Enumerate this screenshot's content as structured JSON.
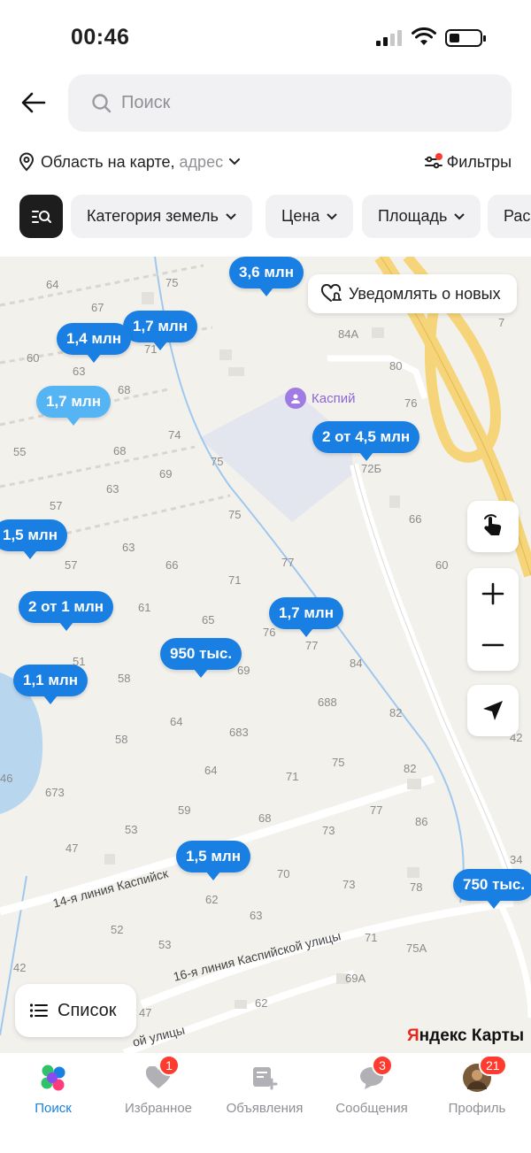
{
  "status_bar": {
    "time": "00:46"
  },
  "search": {
    "placeholder": "Поиск"
  },
  "location": {
    "label": "Область на карте,",
    "muted": "адрес"
  },
  "filters": {
    "label": "Фильтры",
    "accent": "#ff3b30"
  },
  "chips": [
    "Категория земель",
    "Цена",
    "Площадь",
    "Рас"
  ],
  "map": {
    "notify_label": "Уведомлять о новых",
    "poi_label": "Каспий",
    "streets": [
      "14-я линия Каспийск",
      "16-я линия Каспийской улицы",
      "ой улицы"
    ],
    "pins": [
      "3,6 млн",
      "1,7 млн",
      "1,4 млн",
      "1,7 млн",
      "2 от 4,5 млн",
      "1,5 млн",
      "2 от 1 млн",
      "1,7 млн",
      "950 тыс.",
      "1,1 млн",
      "1,5 млн",
      "750 тыс."
    ],
    "plot_numbers": [
      "64",
      "75",
      "67",
      "60",
      "63",
      "71",
      "68",
      "55",
      "74",
      "68",
      "75",
      "69",
      "63",
      "57",
      "75",
      "63",
      "57",
      "66",
      "77",
      "71",
      "61",
      "65",
      "76",
      "77",
      "84",
      "51",
      "58",
      "69",
      "64",
      "688",
      "82",
      "58",
      "683",
      "75",
      "82",
      "64",
      "71",
      "46",
      "673",
      "59",
      "68",
      "53",
      "73",
      "77",
      "86",
      "47",
      "70",
      "73",
      "78",
      "62",
      "63",
      "52",
      "71",
      "53",
      "75А",
      "69А",
      "62",
      "42",
      "47",
      "84А",
      "80",
      "76",
      "72Б",
      "66",
      "60",
      "42",
      "34",
      "7"
    ],
    "list_button": "Список",
    "brand": {
      "y": "Я",
      "rest": "ндекс Карты"
    }
  },
  "nav": [
    {
      "label": "Поиск",
      "active": true
    },
    {
      "label": "Избранное",
      "badge": "1"
    },
    {
      "label": "Объявления"
    },
    {
      "label": "Сообщения",
      "badge": "3"
    },
    {
      "label": "Профиль",
      "badge": "21"
    }
  ],
  "colors": {
    "accent": "#1a7fe3",
    "badge": "#ff3b30",
    "poi": "#a07be3"
  }
}
